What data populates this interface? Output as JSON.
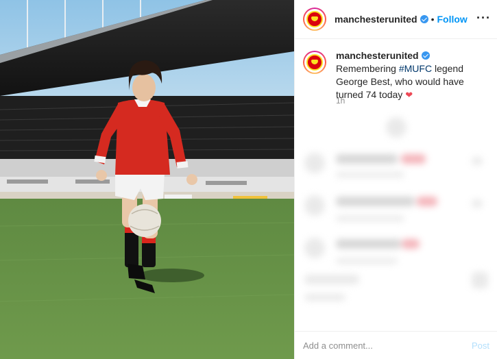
{
  "post": {
    "account": "manchesterunited",
    "follow_label": "Follow",
    "separator": "•",
    "more_icon": "more-horizontal-icon",
    "caption": {
      "user": "manchesterunited",
      "text_before": "Remembering ",
      "hashtag": "#MUFC",
      "text_after": " legend George Best, who would have turned 74 today"
    },
    "heart_glyph": "❤",
    "time_ago": "1h",
    "comment_placeholder": "Add a comment...",
    "post_label": "Post"
  },
  "colors": {
    "link_blue": "#0095f6",
    "verified_blue": "#3897f0",
    "hashtag": "#00376b",
    "heart_red": "#ed4956",
    "united_red": "#da020e"
  }
}
